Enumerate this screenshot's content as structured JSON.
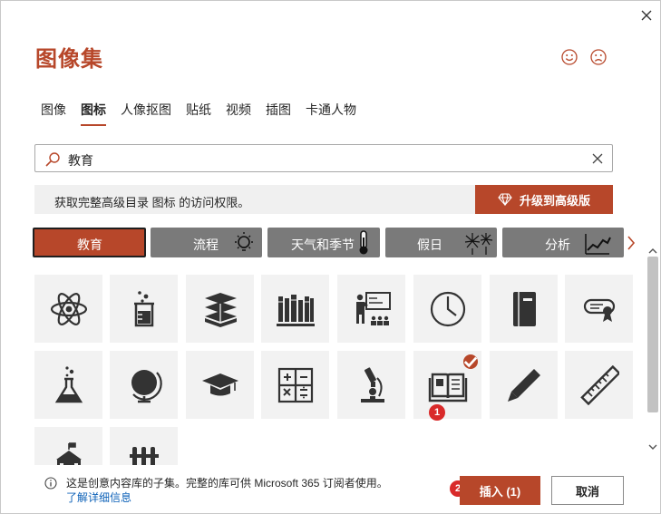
{
  "dialog": {
    "title": "图像集"
  },
  "tabs": [
    {
      "label": "图像",
      "active": false
    },
    {
      "label": "图标",
      "active": true
    },
    {
      "label": "人像抠图",
      "active": false
    },
    {
      "label": "贴纸",
      "active": false
    },
    {
      "label": "视频",
      "active": false
    },
    {
      "label": "插图",
      "active": false
    },
    {
      "label": "卡通人物",
      "active": false
    }
  ],
  "search": {
    "value": "教育"
  },
  "upsell": {
    "message": "获取完整高级目录 图标 的访问权限。",
    "button_label": "升级到高级版"
  },
  "categories": [
    {
      "label": "教育",
      "active": true
    },
    {
      "label": "流程",
      "icon": "lightbulb-icon"
    },
    {
      "label": "天气和季节",
      "icon": "thermometer-icon"
    },
    {
      "label": "假日",
      "icon": "fireworks-icon"
    },
    {
      "label": "分析",
      "icon": "line-chart-icon"
    }
  ],
  "icons": [
    {
      "name": "atom-icon"
    },
    {
      "name": "beaker-icon"
    },
    {
      "name": "books-stack-icon"
    },
    {
      "name": "bookshelf-icon"
    },
    {
      "name": "teacher-presentation-icon"
    },
    {
      "name": "clock-icon"
    },
    {
      "name": "notebook-icon"
    },
    {
      "name": "diploma-icon"
    },
    {
      "name": "flask-icon"
    },
    {
      "name": "globe-icon"
    },
    {
      "name": "graduation-cap-icon"
    },
    {
      "name": "calculator-icon"
    },
    {
      "name": "microscope-icon"
    },
    {
      "name": "open-book-icon",
      "selected": true
    },
    {
      "name": "pencil-icon"
    },
    {
      "name": "ruler-icon"
    },
    {
      "name": "school-building-icon"
    },
    {
      "name": "test-tubes-icon"
    }
  ],
  "badges": {
    "step1": "1",
    "step2": "2"
  },
  "footer": {
    "info": "这是创意内容库的子集。完整的库可供 Microsoft 365 订阅者使用。",
    "link": "了解详细信息"
  },
  "buttons": {
    "insert": "插入 (1)",
    "cancel": "取消"
  },
  "colors": {
    "accent": "#b7472a",
    "category": "#7a7a7a",
    "badge": "#d92a2a",
    "link": "#0e62b8"
  }
}
